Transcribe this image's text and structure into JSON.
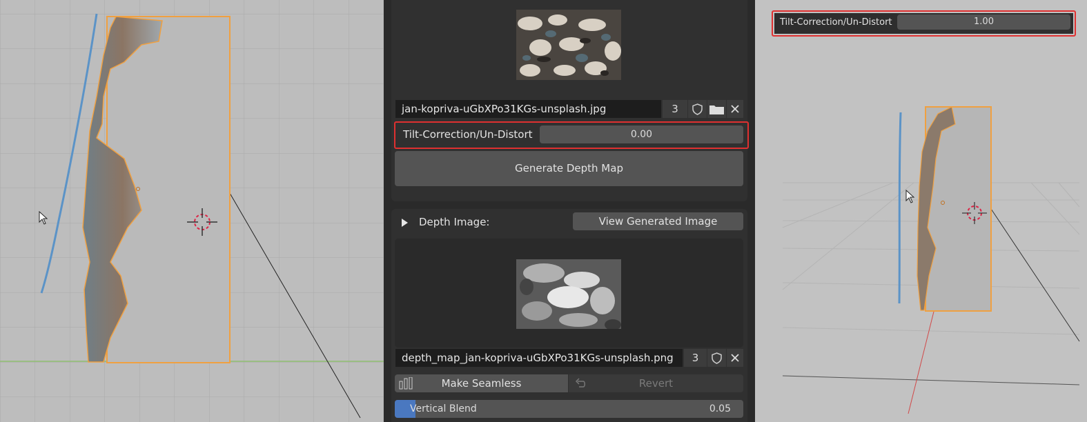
{
  "left_viewport": {
    "label": "3D viewport (front view)"
  },
  "panel": {
    "source_image": {
      "filename": "jan-kopriva-uGbXPo31KGs-unsplash.jpg",
      "user_count": "3"
    },
    "tilt_correction": {
      "label": "Tilt-Correction/Un-Distort",
      "value": "0.00"
    },
    "generate_button": "Generate Depth Map",
    "depth_section": {
      "label": "Depth Image:",
      "view_button": "View Generated Image",
      "filename": "depth_map_jan-kopriva-uGbXPo31KGs-unsplash.png",
      "user_count": "3"
    },
    "make_seamless": "Make Seamless",
    "revert": "Revert",
    "vertical_blend": {
      "label": "Vertical Blend",
      "value": "0.05",
      "fraction": 0.05
    }
  },
  "right_viewport": {
    "tilt_correction": {
      "label": "Tilt-Correction/Un-Distort",
      "value": "1.00"
    }
  },
  "colors": {
    "highlight": "#e03030",
    "selection_outline": "#f0a040",
    "slider_fill": "#4a78c0"
  }
}
